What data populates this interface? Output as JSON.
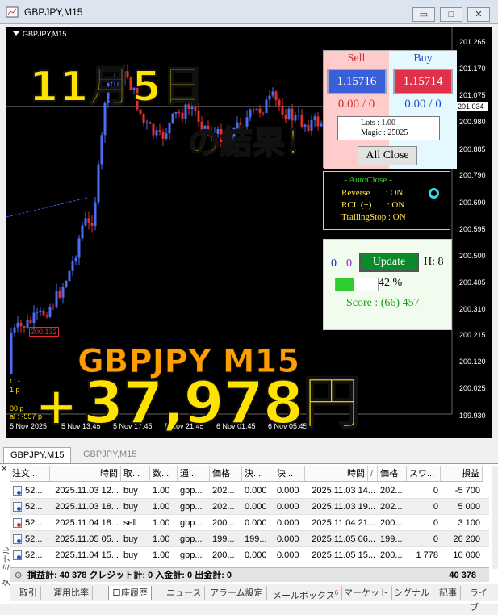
{
  "window": {
    "title": "GBPJPY,M15",
    "buttons": [
      "▭",
      "□",
      "✕"
    ]
  },
  "chart": {
    "symbol_label": "GBPJPY,M15",
    "price_labels": [
      "201.265",
      "201.170",
      "201.075",
      "201.034",
      "200.980",
      "200.885",
      "200.790",
      "200.690",
      "200.595",
      "200.500",
      "200.405",
      "200.310",
      "200.215",
      "200.120",
      "200.025",
      "199.930"
    ],
    "current_price": "201.034",
    "time_labels": [
      "5 Nov 2025",
      "5 Nov 13:45",
      "5 Nov 17:45",
      "5 Nov 21:45",
      "6 Nov 01:45",
      "6 Nov 05:45"
    ],
    "left_labels": [
      "t : -",
      "1 p",
      "00 p",
      "al : -557 p"
    ],
    "marker_label": "200.132",
    "colors": {
      "bull": "#4d6cf5",
      "bear": "#e03030",
      "background": "#000000"
    }
  },
  "overlay": {
    "date": "11月5日",
    "result": "の結果！",
    "symbol": "GBPJPY M15",
    "plus": "+",
    "profit": "37,978円"
  },
  "trade_panel": {
    "sell_label": "Sell",
    "buy_label": "Buy",
    "sell_price": "1.15716",
    "buy_price": "1.15714",
    "sell_count": "0.00 / 0",
    "buy_count": "0.00 / 0",
    "lots": "Lots    : 1.00",
    "magic": "Magic : 25025",
    "all_close": "All Close"
  },
  "autoclose": {
    "title": "- AutoClose -",
    "rows": [
      "Reverse       : ON",
      "RCI  (+)       : ON",
      "TrailingStop : ON"
    ]
  },
  "update_panel": {
    "n1": "0",
    "n2": "0",
    "update_label": "Update",
    "h": "H: 8",
    "percent_text": "42 %",
    "percent_value": 42,
    "score": "Score : (66) 457"
  },
  "chart_tabs": [
    "GBPJPY,M15",
    "GBPJPY,M15"
  ],
  "terminal": {
    "side_label": "ターミナル",
    "headers": [
      "注文...",
      "時間",
      "取...",
      "数...",
      "通...",
      "価格",
      "決...",
      "決...",
      "時間",
      "価格",
      "スワ...",
      "損益"
    ],
    "sort_mark": "/",
    "rows": [
      {
        "icon": "blue",
        "cells": [
          "52...",
          "2025.11.03 12...",
          "buy",
          "1.00",
          "gbp...",
          "202...",
          "0.000",
          "0.000",
          "2025.11.03 14...",
          "202...",
          "0",
          "-5 700"
        ]
      },
      {
        "icon": "blue",
        "cells": [
          "52...",
          "2025.11.03 18...",
          "buy",
          "1.00",
          "gbp...",
          "202...",
          "0.000",
          "0.000",
          "2025.11.03 19...",
          "202...",
          "0",
          "5 000"
        ]
      },
      {
        "icon": "red",
        "cells": [
          "52...",
          "2025.11.04 18...",
          "sell",
          "1.00",
          "gbp...",
          "200...",
          "0.000",
          "0.000",
          "2025.11.04 21...",
          "200...",
          "0",
          "3 100"
        ]
      },
      {
        "icon": "blue",
        "cells": [
          "52...",
          "2025.11.05 05...",
          "buy",
          "1.00",
          "gbp...",
          "199...",
          "199...",
          "0.000",
          "2025.11.05 06...",
          "199...",
          "0",
          "26 200"
        ]
      },
      {
        "icon": "blue",
        "cells": [
          "52...",
          "2025.11.04 15...",
          "buy",
          "1.00",
          "gbp...",
          "200...",
          "0.000",
          "0.000",
          "2025.11.05 15...",
          "200...",
          "1 778",
          "10 000"
        ]
      }
    ],
    "summary": "損益計: 40 378  クレジット計: 0  入金計: 0  出金計: 0",
    "summary_total": "40 378",
    "bottom_tabs": [
      "取引",
      "運用比率",
      "口座履歴",
      "ニュース",
      "アラーム設定",
      "メールボックス",
      "マーケット",
      "シグナル",
      "記事",
      "ライブ"
    ],
    "mailbox_badge": "6",
    "selected_tab": "口座履歴"
  }
}
